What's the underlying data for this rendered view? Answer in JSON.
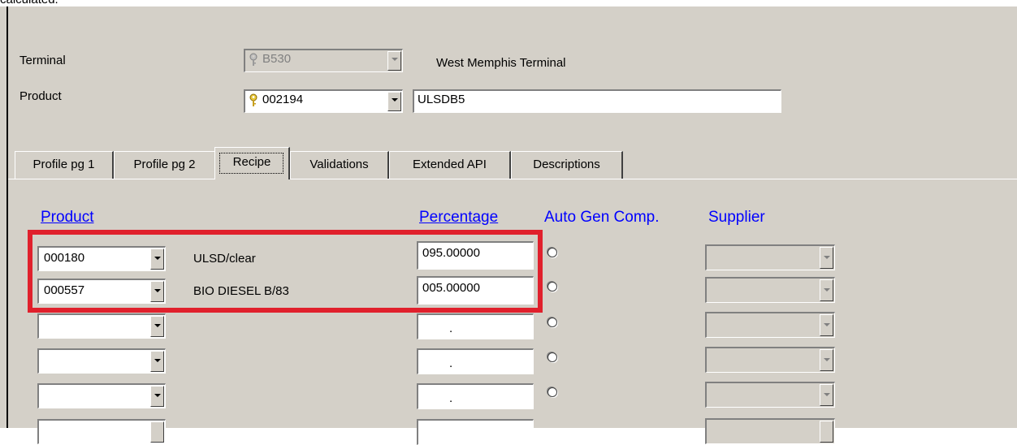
{
  "caption": "calculated.",
  "terminal": {
    "label": "Terminal",
    "code": "B530",
    "name": "West Memphis Terminal"
  },
  "product": {
    "label": "Product",
    "code": "002194",
    "name": "ULSDB5"
  },
  "tabs": [
    "Profile pg 1",
    "Profile pg 2",
    "Recipe",
    "Validations",
    "Extended API",
    "Descriptions"
  ],
  "active_tab": "Recipe",
  "recipe": {
    "headers": {
      "product": "Product",
      "percentage": "Percentage",
      "auto_gen": "Auto Gen Comp.",
      "supplier": "Supplier"
    },
    "rows": [
      {
        "product": "000180",
        "name": "ULSD/clear",
        "percentage": "095.00000"
      },
      {
        "product": "000557",
        "name": "BIO DIESEL B/83",
        "percentage": "005.00000"
      },
      {
        "product": "",
        "name": "",
        "percentage": "."
      },
      {
        "product": "",
        "name": "",
        "percentage": "."
      },
      {
        "product": "",
        "name": "",
        "percentage": "."
      }
    ]
  },
  "colors": {
    "highlight_box": "#e0202c",
    "header_text": "#0000ff",
    "window_bg": "#d4d0c8"
  }
}
